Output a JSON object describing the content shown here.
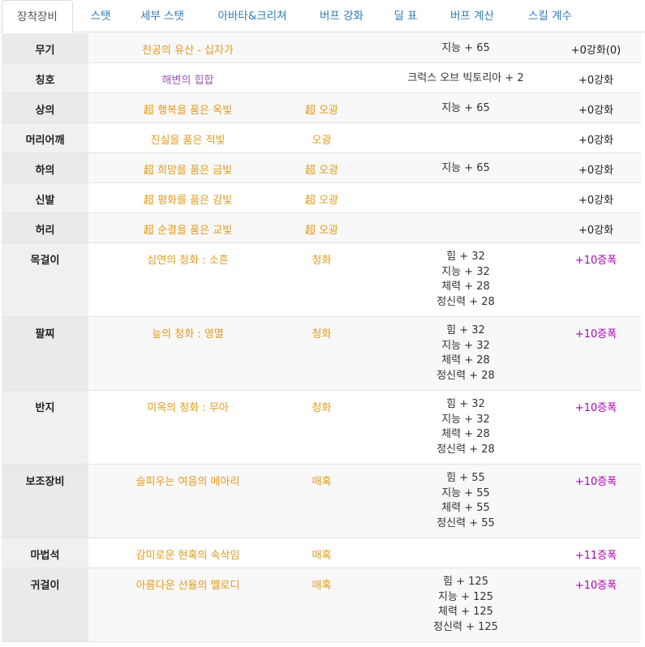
{
  "tabs": [
    "장착장비",
    "스탯",
    "세부 스탯",
    "아바타&크리쳐",
    "버프 강화",
    "딜 표",
    "버프 계산",
    "스킬 계수"
  ],
  "rows": [
    {
      "slot": "무기",
      "name": "천공의 유산 - 십자가",
      "sub": "",
      "stats": [
        "지능 + 65"
      ],
      "enh": "+0강화(0)"
    },
    {
      "slot": "칭호",
      "name": "해변의 힙합",
      "sub": "",
      "stats": [
        "크럭스 오브 빅토리아 + 2"
      ],
      "enh": "+0강화"
    },
    {
      "slot": "상의",
      "name": "超 행복을 품은 옥빛",
      "sub": "超 오광",
      "stats": [
        "지능 + 65"
      ],
      "enh": "+0강화"
    },
    {
      "slot": "머리어깨",
      "name": "진실을 품은 적빛",
      "sub": "오광",
      "stats": [],
      "enh": "+0강화"
    },
    {
      "slot": "하의",
      "name": "超 희망을 품은 금빛",
      "sub": "超 오광",
      "stats": [
        "지능 + 65"
      ],
      "enh": "+0강화"
    },
    {
      "slot": "신발",
      "name": "超 평화를 품은 감빛",
      "sub": "超 오광",
      "stats": [],
      "enh": "+0강화"
    },
    {
      "slot": "허리",
      "name": "超 순결을 품은 교빛",
      "sub": "超 오광",
      "stats": [],
      "enh": "+0강화"
    },
    {
      "slot": "목걸이",
      "name": "심연의 청화 : 소흔",
      "sub": "청화",
      "stats": [
        "힘 + 32",
        "지능 + 32",
        "체력 + 28",
        "정신력 + 28"
      ],
      "enh": "+10증폭"
    },
    {
      "slot": "팔찌",
      "name": "늪의 청화 : 영멸",
      "sub": "청화",
      "stats": [
        "힘 + 32",
        "지능 + 32",
        "체력 + 28",
        "정신력 + 28"
      ],
      "enh": "+10증폭"
    },
    {
      "slot": "반지",
      "name": "미옥의 청화 : 무아",
      "sub": "청화",
      "stats": [
        "힘 + 32",
        "지능 + 32",
        "체력 + 28",
        "정신력 + 28"
      ],
      "enh": "+10증폭"
    },
    {
      "slot": "보조장비",
      "name": "슬피우는 여음의 메아리",
      "sub": "매혹",
      "stats": [
        "힘 + 55",
        "지능 + 55",
        "체력 + 55",
        "정신력 + 55"
      ],
      "enh": "+10증폭"
    },
    {
      "slot": "마법석",
      "name": "감미로운 현혹의 속삭임",
      "sub": "매혹",
      "stats": [],
      "enh": "+11증폭"
    },
    {
      "slot": "귀걸이",
      "name": "아름다운 선율의 멜로디",
      "sub": "매혹",
      "stats": [
        "힘 + 125",
        "지능 + 125",
        "체력 + 125",
        "정신력 + 125"
      ],
      "enh": "+10증폭"
    }
  ],
  "colors": {
    "name_default": "#e39a1c",
    "name_title": "#9b59b6",
    "enh_amp": "#b000b5",
    "tab_link": "#337ab7"
  }
}
